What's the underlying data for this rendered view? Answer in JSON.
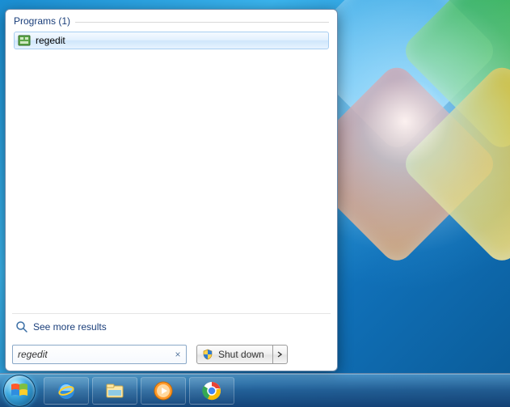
{
  "start_menu": {
    "section_label": "Programs (1)",
    "results": [
      {
        "label": "regedit"
      }
    ],
    "see_more_label": "See more results",
    "search_value": "regedit",
    "shutdown_label": "Shut down"
  }
}
